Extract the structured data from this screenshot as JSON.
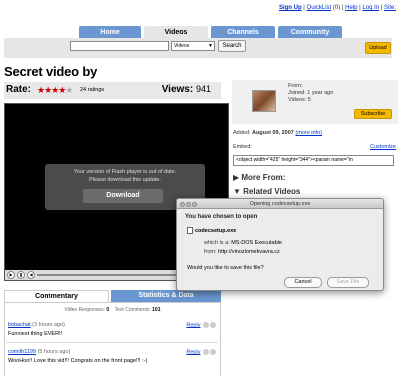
{
  "toplinks": {
    "signup": "Sign Up",
    "quicklist": "QuickList",
    "quicklist_count": "(0)",
    "help": "Help",
    "login": "Log In",
    "site": "Site:",
    "separator": "|"
  },
  "nav": {
    "tabs": [
      "Home",
      "Videos",
      "Channels",
      "Community"
    ],
    "active_tab": "Videos"
  },
  "search": {
    "value": "",
    "select_value": "Videos",
    "button": "Search"
  },
  "upload_button": "Upload",
  "video": {
    "title": "Secret video by",
    "rate_label": "Rate:",
    "stars_filled": 4,
    "stars_total": 5,
    "ratings_text": "24 ratings",
    "views_label": "Views:",
    "views_value": "941"
  },
  "player": {
    "message_line1": "Your version of Flash player is out of date.",
    "message_line2": "Please download this update.",
    "download_button": "Download"
  },
  "commentary": {
    "tab_comments": "Commentary",
    "tab_stats": "Statistics & Data",
    "video_responses_label": "Video Responses:",
    "video_responses_value": "0",
    "text_comments_label": "Text Comments:",
    "text_comments_value": "101",
    "comments": [
      {
        "user": "bobachat",
        "time": "(3 hours ago)",
        "reply": "Reply",
        "text": "Funniest thing EVER!!"
      },
      {
        "user": "comith1199",
        "time": "(5 hours ago)",
        "reply": "Reply",
        "text": "WooHoo!! Love this vid!!! Congrats on the front page!!! :-)"
      }
    ]
  },
  "sidebar": {
    "from_label": "From:",
    "joined": "Joined: 1 year ago",
    "videos": "Videos: 5",
    "subscribe": "Subscribe",
    "added_label": "Added:",
    "added_date": "August 09, 2007",
    "more_info": "(more info)",
    "embed_label": "Embed:",
    "customize": "Customize",
    "embed_code": "<object width=\"425\" height=\"344\"><param name=\"m",
    "more_from": "▶ More From:",
    "related": "▼ Related Videos"
  },
  "dialog": {
    "window_title": "Opening codecsetup.exe",
    "heading": "You have chosen to open",
    "filename": "codecsetup.exe",
    "which_is_label": "which is a:",
    "which_is_value": "MS-DOS Executable",
    "from_label": "from:",
    "from_value": "http://vinozlomekvavra.cz",
    "question": "Would you like to save this file?",
    "cancel": "Cancel",
    "save": "Save File"
  }
}
